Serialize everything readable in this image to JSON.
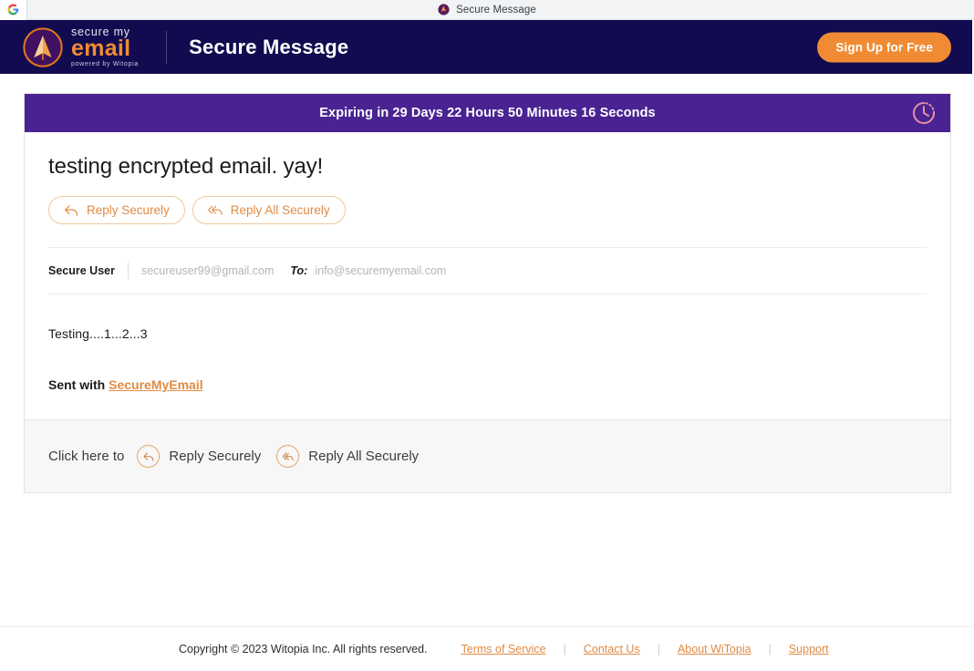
{
  "browser": {
    "tab_favicon_icon": "google-icon",
    "page_favicon_icon": "securemyemail-drop-icon",
    "tab_title": "Secure Message"
  },
  "header": {
    "logo": {
      "icon": "paper-plane-badge-icon",
      "line1": "secure my",
      "line2": "email",
      "tagline": "powered by Witopia"
    },
    "title": "Secure Message",
    "signup_button": "Sign Up for Free",
    "background_color": "#120b4f",
    "accent_color": "#f08b34"
  },
  "banner": {
    "text": "Expiring in 29 Days 22 Hours 50 Minutes 16 Seconds",
    "icon": "clock-icon",
    "background_color": "#4a2392"
  },
  "message": {
    "subject": "testing encrypted email. yay!",
    "top_actions": [
      {
        "label": "Reply Securely",
        "icon": "reply-arrow-icon"
      },
      {
        "label": "Reply All Securely",
        "icon": "reply-all-arrow-icon"
      }
    ],
    "sender_name": "Secure User",
    "sender_email": "secureuser99@gmail.com",
    "to_label": "To:",
    "to_email": "info@securemyemail.com",
    "body": "Testing....1...2...3",
    "signature_prefix": "Sent with ",
    "signature_link": "SecureMyEmail"
  },
  "card_footer": {
    "prompt": "Click here to",
    "actions": [
      {
        "label": "Reply Securely",
        "icon": "reply-circle-icon"
      },
      {
        "label": "Reply All Securely",
        "icon": "reply-all-circle-icon"
      }
    ]
  },
  "footer": {
    "copyright": "Copyright © 2023 Witopia Inc. All rights reserved.",
    "links": [
      "Terms of Service",
      "Contact Us",
      "About WiTopia",
      "Support"
    ],
    "separator": "|"
  }
}
